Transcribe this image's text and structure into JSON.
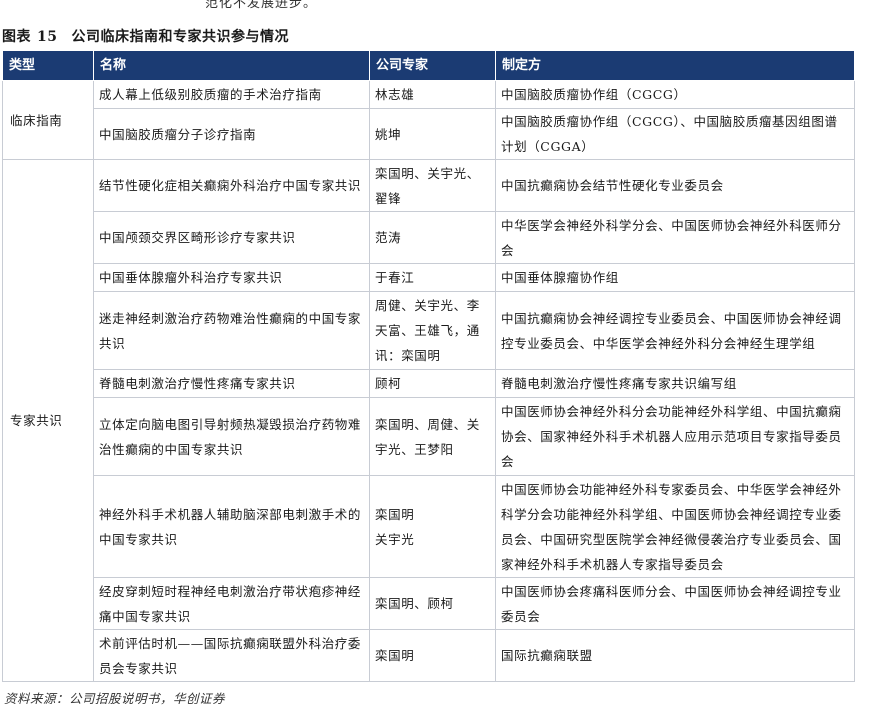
{
  "top_fragment": "范化不发展进步。",
  "caption": {
    "label": "图表",
    "number": "15",
    "title": "公司临床指南和专家共识参与情况"
  },
  "table": {
    "headers": [
      "类型",
      "名称",
      "公司专家",
      "制定方"
    ],
    "groups": [
      {
        "type": "临床指南",
        "rows": [
          {
            "name": "成人幕上低级别胶质瘤的手术治疗指南",
            "experts": "林志雄",
            "issuer": "中国脑胶质瘤协作组（CGCG）"
          },
          {
            "name": "中国脑胶质瘤分子诊疗指南",
            "experts": "姚坤",
            "issuer": "中国脑胶质瘤协作组（CGCG）、中国脑胶质瘤基因组图谱计划（CGGA）"
          }
        ]
      },
      {
        "type": "专家共识",
        "rows": [
          {
            "name": "结节性硬化症相关癫痫外科治疗中国专家共识",
            "experts": "栾国明、关宇光、翟锋",
            "issuer": "中国抗癫痫协会结节性硬化专业委员会"
          },
          {
            "name": "中国颅颈交界区畸形诊疗专家共识",
            "experts": "范涛",
            "issuer": "中华医学会神经外科学分会、中国医师协会神经外科医师分会"
          },
          {
            "name": "中国垂体腺瘤外科治疗专家共识",
            "experts": "于春江",
            "issuer": "中国垂体腺瘤协作组"
          },
          {
            "name": "迷走神经刺激治疗药物难治性癫痫的中国专家共识",
            "experts": "周健、关宇光、李天富、王雄飞，通讯：栾国明",
            "issuer": "中国抗癫痫协会神经调控专业委员会、中国医师协会神经调控专业委员会、中华医学会神经外科分会神经生理学组"
          },
          {
            "name": "脊髓电刺激治疗慢性疼痛专家共识",
            "experts": "顾柯",
            "issuer": "脊髓电刺激治疗慢性疼痛专家共识编写组"
          },
          {
            "name": "立体定向脑电图引导射频热凝毁损治疗药物难治性癫痫的中国专家共识",
            "experts": "栾国明、周健、关宇光、王梦阳",
            "issuer": "中国医师协会神经外科分会功能神经外科学组、中国抗癫痫协会、国家神经外科手术机器人应用示范项目专家指导委员会"
          },
          {
            "name": "神经外科手术机器人辅助脑深部电刺激手术的中国专家共识",
            "experts": "栾国明\n关宇光",
            "issuer": "中国医师协会功能神经外科专家委员会、中华医学会神经外科学分会功能神经外科学组、中国医师协会神经调控专业委员会、中国研究型医院学会神经微侵袭治疗专业委员会、国家神经外科手术机器人专家指导委员会"
          },
          {
            "name": "经皮穿刺短时程神经电刺激治疗带状疱疹神经痛中国专家共识",
            "experts": "栾国明、顾柯",
            "issuer": "中国医师协会疼痛科医师分会、中国医师协会神经调控专业委员会"
          },
          {
            "name": "术前评估时机——国际抗癫痫联盟外科治疗委员会专家共识",
            "experts": "栾国明",
            "issuer": "国际抗癫痫联盟"
          }
        ]
      }
    ]
  },
  "source": "资料来源：公司招股说明书，华创证券"
}
